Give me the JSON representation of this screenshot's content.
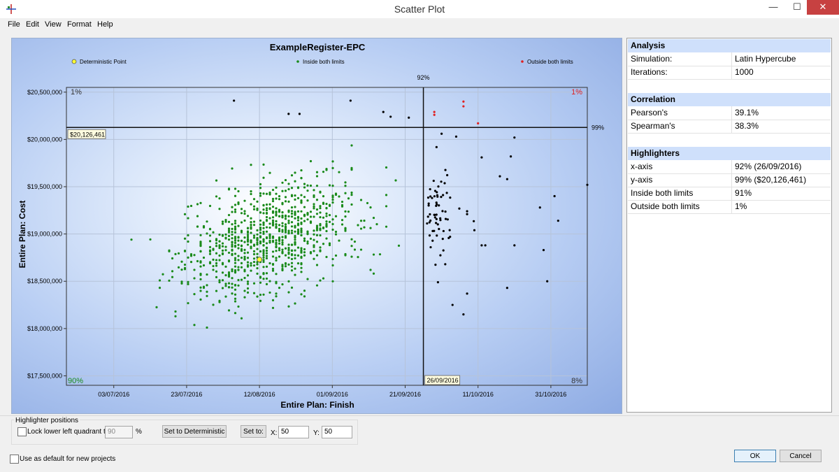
{
  "window": {
    "title": "Scatter Plot",
    "minimize": "—",
    "maximize": "☐",
    "close": "✕"
  },
  "menu": [
    "File",
    "Edit",
    "View",
    "Format",
    "Help"
  ],
  "chart_data": {
    "type": "scatter",
    "title": "ExampleRegister-EPC",
    "xlabel": "Entire Plan: Finish",
    "ylabel": "Entire Plan: Cost",
    "x_ticks": [
      "03/07/2016",
      "23/07/2016",
      "12/08/2016",
      "01/09/2016",
      "21/09/2016",
      "11/10/2016",
      "31/10/2016"
    ],
    "xlim": [
      "2016-06-20",
      "2016-11-10"
    ],
    "y_ticks": [
      "$17,500,000",
      "$18,000,000",
      "$18,500,000",
      "$19,000,000",
      "$19,500,000",
      "$20,000,000",
      "$20,500,000"
    ],
    "ylim": [
      17400000,
      20550000
    ],
    "legend": [
      {
        "name": "Deterministic Point",
        "color": "#ffff33"
      },
      {
        "name": "Inside both limits",
        "color": "#1a8a1a"
      },
      {
        "name": "Outside both limits",
        "color": "#e02020"
      }
    ],
    "legend_position": "top",
    "grid": true,
    "highlighter": {
      "x": "2016-09-26",
      "x_label": "26/09/2016",
      "x_pct_label": "92%",
      "y": 20126461,
      "y_label": "$20,126,461",
      "y_pct_label": "99%"
    },
    "quadrants": {
      "top_left": "1%",
      "top_right": "1%",
      "bottom_left": "90%",
      "bottom_right": "8%"
    },
    "deterministic_point": {
      "x": "2016-08-12",
      "y": 18730000
    },
    "colors": {
      "inside": "#1a8a1a",
      "outside": "#e02020",
      "other": "#000000"
    },
    "series_note_count": 1000,
    "outside_points": [
      {
        "x": "2016-09-29",
        "y": 20290000
      },
      {
        "x": "2016-09-29",
        "y": 20260000
      },
      {
        "x": "2016-10-07",
        "y": 20400000
      },
      {
        "x": "2016-10-07",
        "y": 20350000
      },
      {
        "x": "2016-10-11",
        "y": 20170000
      }
    ],
    "black_points": [
      {
        "x": "2016-08-05",
        "y": 20410000
      },
      {
        "x": "2016-08-20",
        "y": 20270000
      },
      {
        "x": "2016-08-23",
        "y": 20270000
      },
      {
        "x": "2016-09-06",
        "y": 20410000
      },
      {
        "x": "2016-09-15",
        "y": 20290000
      },
      {
        "x": "2016-09-17",
        "y": 20240000
      },
      {
        "x": "2016-09-22",
        "y": 20230000
      },
      {
        "x": "2016-10-01",
        "y": 20060000
      },
      {
        "x": "2016-10-05",
        "y": 20030000
      },
      {
        "x": "2016-10-12",
        "y": 19810000
      },
      {
        "x": "2016-10-20",
        "y": 19820000
      },
      {
        "x": "2016-10-21",
        "y": 20020000
      },
      {
        "x": "2016-10-17",
        "y": 19610000
      },
      {
        "x": "2016-10-19",
        "y": 19580000
      },
      {
        "x": "2016-10-28",
        "y": 19280000
      },
      {
        "x": "2016-11-01",
        "y": 19400000
      },
      {
        "x": "2016-11-10",
        "y": 19520000
      },
      {
        "x": "2016-11-02",
        "y": 19140000
      },
      {
        "x": "2016-10-08",
        "y": 19240000
      },
      {
        "x": "2016-10-08",
        "y": 19210000
      },
      {
        "x": "2016-10-10",
        "y": 19040000
      },
      {
        "x": "2016-10-12",
        "y": 18880000
      },
      {
        "x": "2016-10-13",
        "y": 18880000
      },
      {
        "x": "2016-10-21",
        "y": 18880000
      },
      {
        "x": "2016-10-29",
        "y": 18830000
      },
      {
        "x": "2016-10-30",
        "y": 18500000
      },
      {
        "x": "2016-10-19",
        "y": 18430000
      },
      {
        "x": "2016-10-02",
        "y": 18680000
      },
      {
        "x": "2016-10-08",
        "y": 18370000
      },
      {
        "x": "2016-10-07",
        "y": 18150000
      },
      {
        "x": "2016-10-04",
        "y": 18250000
      },
      {
        "x": "2016-09-30",
        "y": 18490000
      },
      {
        "x": "2016-09-28",
        "y": 18860000
      }
    ],
    "generated_cloud": "inside-limits points rendered by script around the deterministic point"
  },
  "side": {
    "analysis": {
      "head": "Analysis",
      "rows": [
        [
          "Simulation:",
          "Latin Hypercube"
        ],
        [
          "Iterations:",
          "1000"
        ]
      ]
    },
    "correlation": {
      "head": "Correlation",
      "rows": [
        [
          "Pearson's",
          "39.1%"
        ],
        [
          "Spearman's",
          "38.3%"
        ]
      ]
    },
    "highlighters": {
      "head": "Highlighters",
      "rows": [
        [
          "x-axis",
          "92% (26/09/2016)"
        ],
        [
          "y-axis",
          "99% ($20,126,461)"
        ],
        [
          "Inside both limits",
          "91%"
        ],
        [
          "Outside both limits",
          "1%"
        ]
      ]
    }
  },
  "bottom": {
    "group_label": "Highlighter positions",
    "lock_label": "Lock lower left quadrant to",
    "lock_value": "90",
    "pct": "%",
    "set_det_button": "Set to Deterministic",
    "set_to_button": "Set to:",
    "x_label": "X:",
    "x_value": "50",
    "y_label": "Y:",
    "y_value": "50",
    "default_label": "Use as default for new projects",
    "ok": "OK",
    "cancel": "Cancel"
  }
}
